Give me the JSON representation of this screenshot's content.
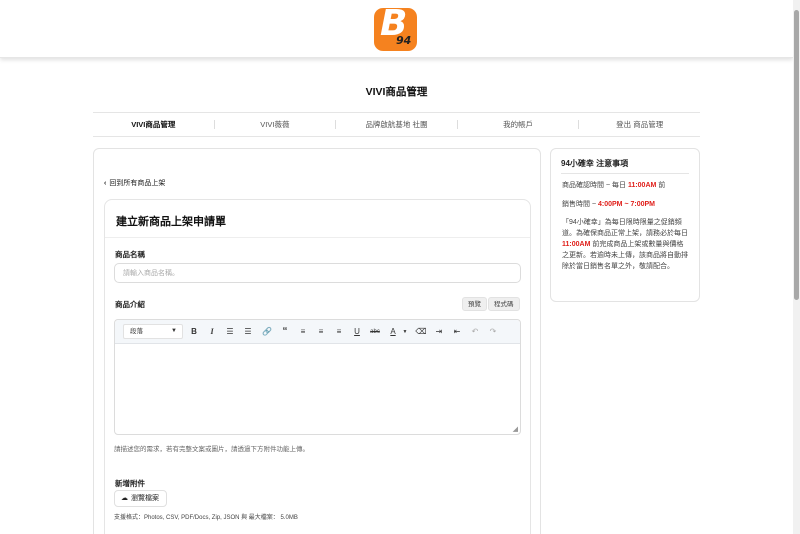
{
  "header": {
    "logo_letter": "B",
    "logo_number": "94",
    "brand_color": "#f5821f"
  },
  "page_title": "VIVI商品管理",
  "nav": {
    "items": [
      {
        "label": "VIVI商品管理",
        "active": true
      },
      {
        "label": "VIVI薇薇"
      },
      {
        "label": "品牌啟航基地 社團"
      },
      {
        "label": "我的帳戶"
      },
      {
        "label": "登出 商品管理"
      }
    ]
  },
  "main": {
    "back_link": "回到所有商品上架",
    "form_title": "建立新商品上架申請單",
    "product_name": {
      "label": "商品名稱",
      "value": "",
      "placeholder": "請輸入商品名稱。"
    },
    "product_intro": {
      "label": "商品介紹",
      "preview_button": "預覽",
      "code_button": "程式碼",
      "format_select": "段落",
      "hint": "請描述您的需求，若有完整文案或圖片，請透過下方附件功能上傳。"
    },
    "attachments": {
      "label": "新增附件",
      "browse_button": "瀏覽檔案",
      "formats": "支援格式：Photos, CSV, PDF/Docs, Zip, JSON 與 最大檔案： 5.0MB"
    }
  },
  "sidebar": {
    "title": "94小確幸 注意事項",
    "confirm_prefix": "商品確認時間 ~ 每日 ",
    "confirm_time": "11:00AM",
    "confirm_suffix": " 前",
    "sales_prefix": "銷售時間 ~ ",
    "sales_time": "4:00PM ~ 7:00PM",
    "notice_1": "「94小確幸」為每日限時限量之促銷頻道。為確保商品正常上架，請務必於每日 ",
    "notice_time": "11:00AM",
    "notice_2": " 前完成商品上架或數量與價格之更新。若逾時未上傳，該商品將自動排除於當日銷售名單之外，敬請配合。",
    "accent_color": "#e0201b"
  }
}
